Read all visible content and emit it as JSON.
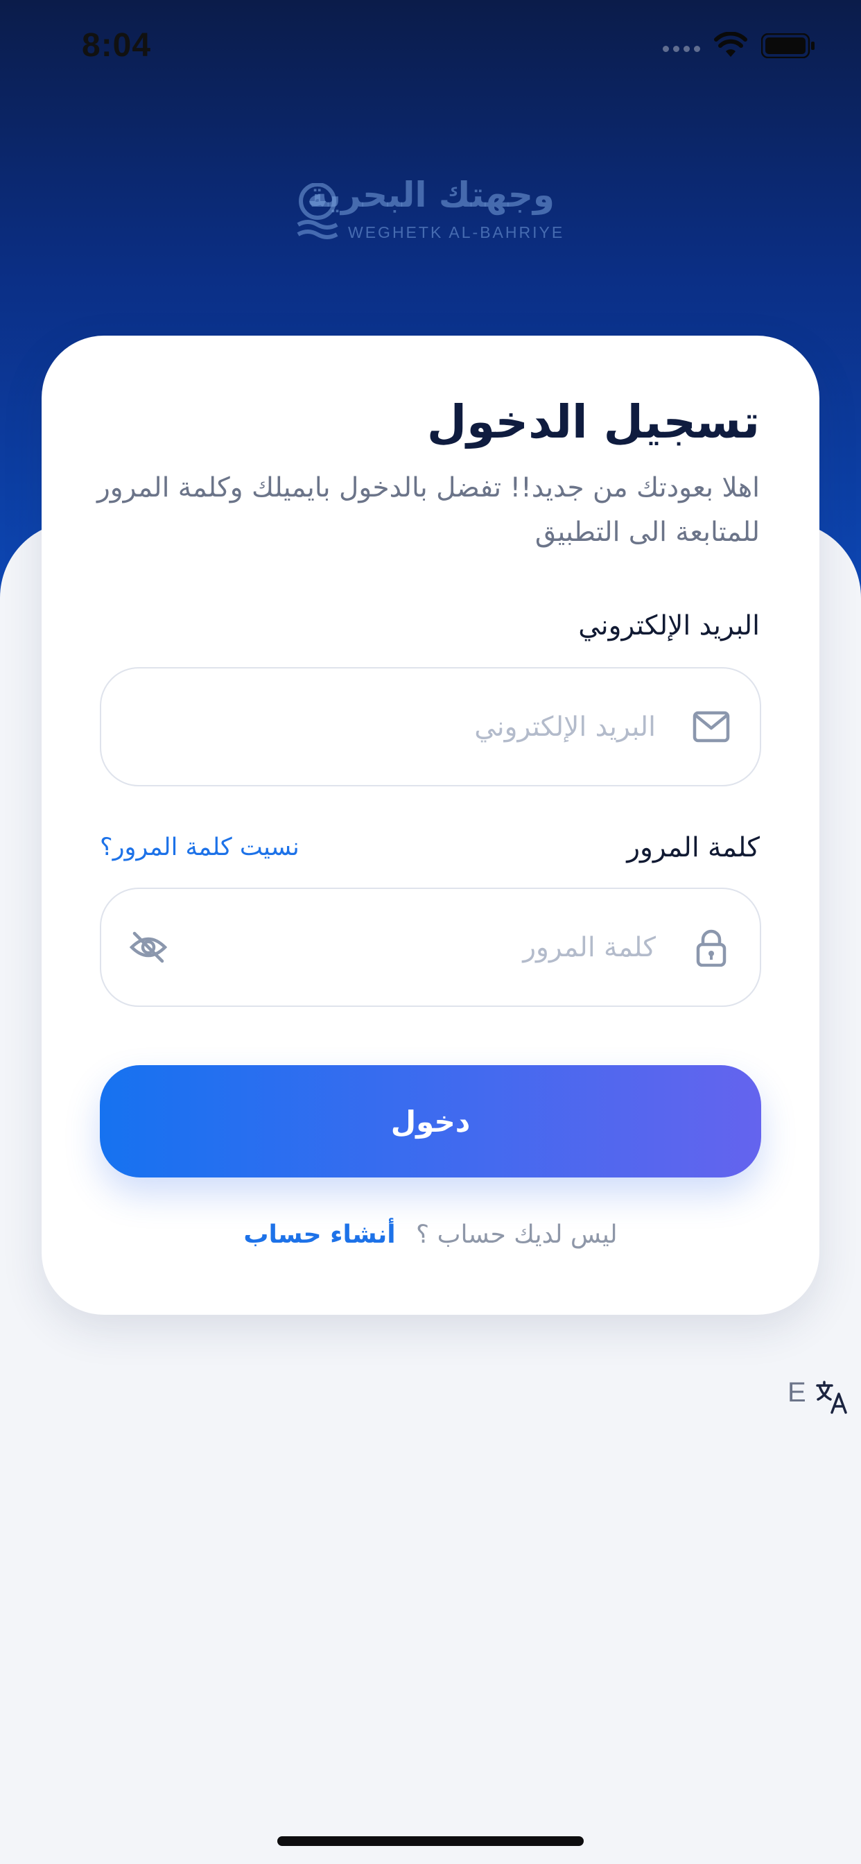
{
  "status_bar": {
    "time": "8:04"
  },
  "brand": {
    "name_ar": "وجهتك البحرية",
    "name_en": "WEGHETK AL-BAHRIYE"
  },
  "login": {
    "title": "تسجيل الدخول",
    "subtitle": "اهلا بعودتك من جديد!! تفضل بالدخول بايميلك وكلمة المرور للمتابعة الى التطبيق",
    "email_label": "البريد الإلكتروني",
    "email_placeholder": "البريد الإلكتروني",
    "email_value": "",
    "password_label": "كلمة المرور",
    "password_placeholder": "كلمة المرور",
    "password_value": "",
    "forgot_password": "نسيت كلمة المرور؟",
    "submit_label": "دخول",
    "no_account_text": "ليس لديك حساب ؟",
    "create_account": "أنشاء حساب"
  },
  "language": {
    "toggle_label": "E"
  },
  "icons": {
    "email": "mail-icon",
    "password": "lock-icon",
    "visibility": "eye-off-icon",
    "translate": "translate-icon",
    "logo": "boat-logo-icon"
  },
  "colors": {
    "accent": "#1d72e8",
    "button_start": "#1672f0",
    "button_end": "#6464ee",
    "hero_top": "#0b1c4a"
  }
}
